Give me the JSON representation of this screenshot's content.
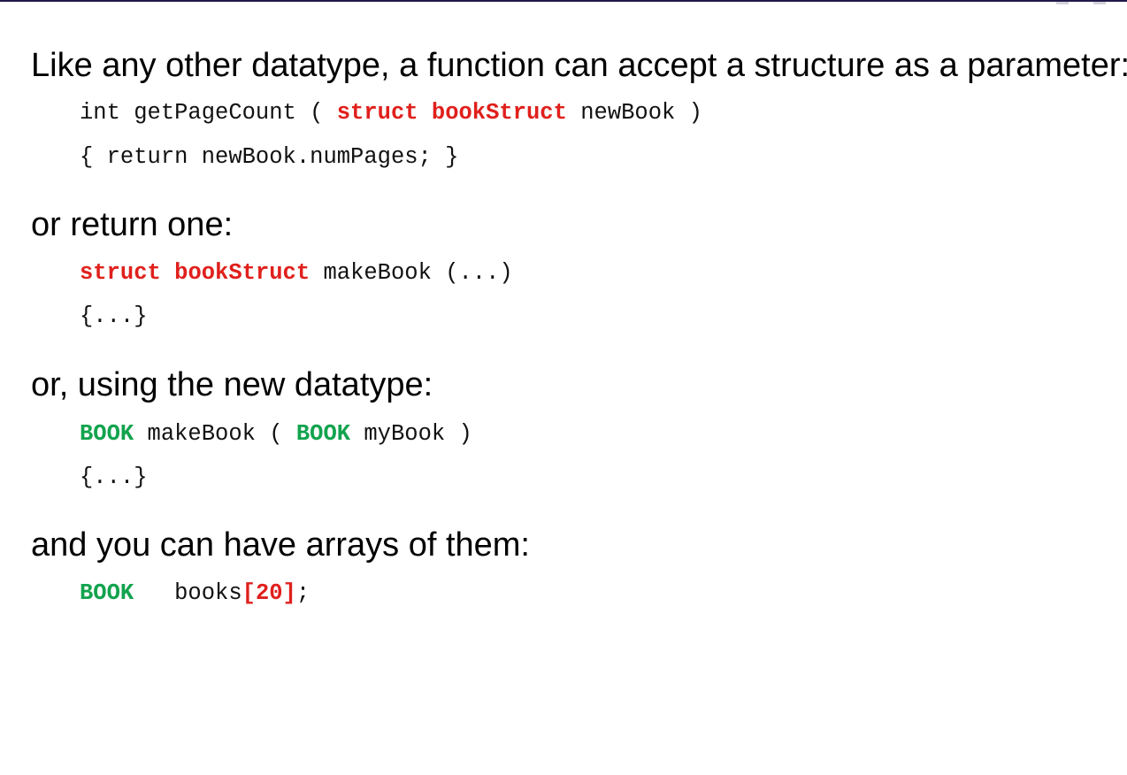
{
  "colors": {
    "top_rule": "#1f1a4a",
    "struct_keyword": "#e0201c",
    "typedef_keyword": "#12a34e",
    "text": "#000000"
  },
  "section_param": {
    "heading": "Like any other datatype, a function can accept a structure as a parameter:",
    "line1": {
      "before": "int getPageCount ( ",
      "kw_struct": "struct",
      "space": " ",
      "kw_type": "bookStruct",
      "after": " newBook )"
    },
    "line2": "{ return newBook.numPages; }"
  },
  "section_return": {
    "heading": "or return one:",
    "line1": {
      "kw_struct": "struct",
      "space": " ",
      "kw_type": "bookStruct",
      "after": " makeBook (...)"
    },
    "line2": "{...}"
  },
  "section_typedef": {
    "heading": "or, using the new datatype:",
    "line1": {
      "kw_type1": "BOOK",
      "middle": " makeBook ( ",
      "kw_type2": "BOOK",
      "after": " myBook )"
    },
    "line2": "{...}"
  },
  "section_arrays": {
    "heading": "and you can have arrays of them:",
    "line1": {
      "kw_type": "BOOK",
      "middle": "   books",
      "array_size": "[20]",
      "after": ";"
    }
  }
}
